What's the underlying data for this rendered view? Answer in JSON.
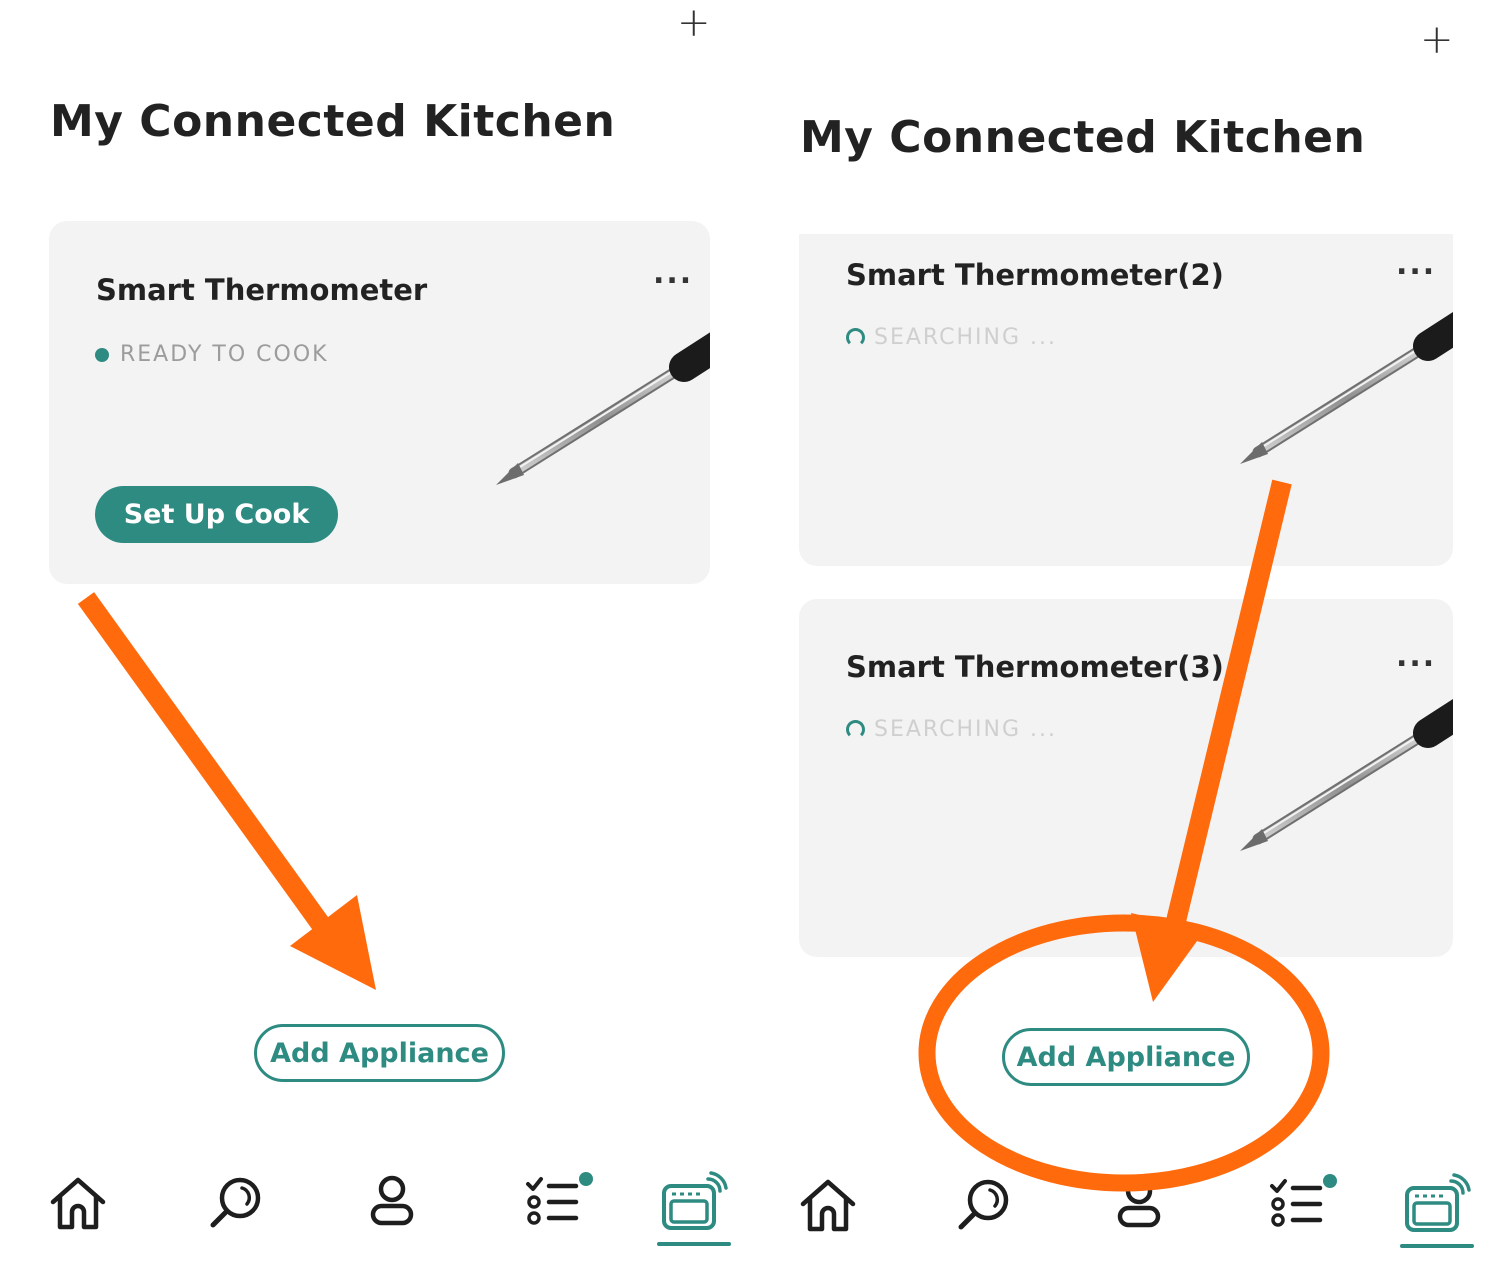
{
  "screens": [
    {
      "header": {
        "add_icon": "+",
        "title": "My Connected Kitchen"
      },
      "cards": [
        {
          "title": "Smart Thermometer",
          "status": "READY TO COOK",
          "more": "...",
          "action_label": "Set Up Cook"
        }
      ],
      "add_appliance_label": "Add Appliance",
      "nav": [
        "home-icon",
        "search-icon",
        "profile-icon",
        "checklist-icon",
        "appliance-icon"
      ],
      "nav_active": "appliance-icon"
    },
    {
      "header": {
        "add_icon": "+",
        "title": "My Connected Kitchen"
      },
      "cards": [
        {
          "title": "Smart Thermometer(2)",
          "status": "SEARCHING ...",
          "more": "..."
        },
        {
          "title": "Smart Thermometer(3)",
          "status": "SEARCHING ...",
          "more": "..."
        }
      ],
      "add_appliance_label": "Add Appliance",
      "nav": [
        "home-icon",
        "search-icon",
        "profile-icon",
        "checklist-icon",
        "appliance-icon"
      ],
      "nav_active": "appliance-icon"
    }
  ],
  "colors": {
    "accent": "#2e8b82",
    "annotation": "#ff6a0d",
    "card_bg": "#f4f3f3"
  }
}
